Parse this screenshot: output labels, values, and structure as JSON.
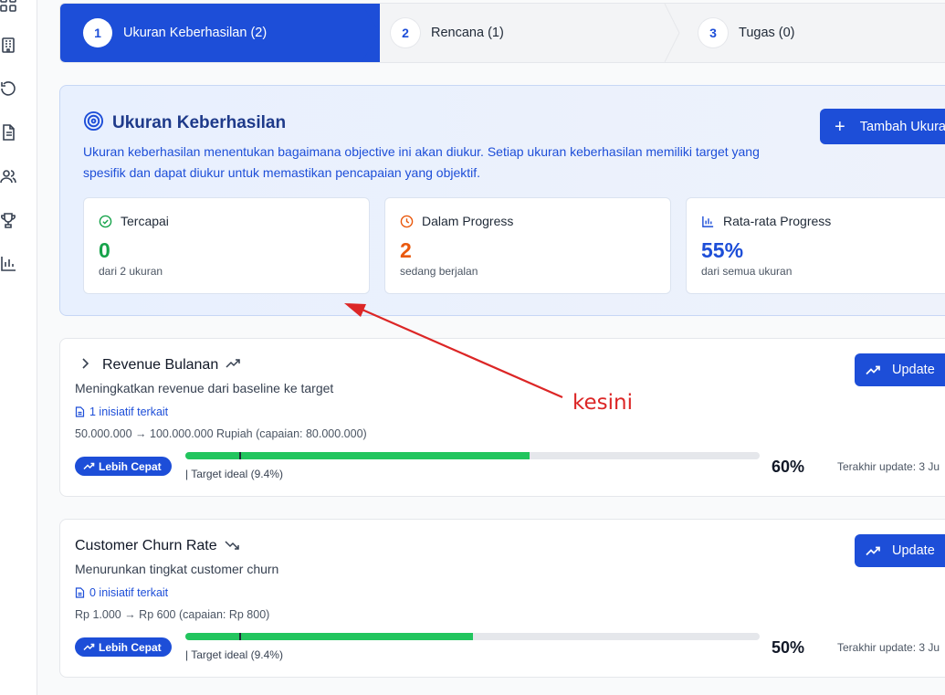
{
  "sidebar": {
    "icons": [
      "grid-icon",
      "building-icon",
      "history-icon",
      "document-icon",
      "users-icon",
      "trophy-icon",
      "bar-chart-icon"
    ]
  },
  "stepper": {
    "steps": [
      {
        "num": "1",
        "label": "Ukuran Keberhasilan (2)",
        "active": true
      },
      {
        "num": "2",
        "label": "Rencana (1)",
        "active": false
      },
      {
        "num": "3",
        "label": "Tugas (0)",
        "active": false
      }
    ]
  },
  "summary": {
    "title": "Ukuran Keberhasilan",
    "description": "Ukuran keberhasilan menentukan bagaimana objective ini akan diukur. Setiap ukuran keberhasilan memiliki target yang spesifik dan dapat diukur untuk memastikan pencapaian yang objektif.",
    "add_button": "Tambah Ukuran",
    "stats": [
      {
        "icon": "check-circle-icon",
        "label": "Tercapai",
        "value": "0",
        "sub": "dari 2 ukuran",
        "color": "#16a34a"
      },
      {
        "icon": "clock-icon",
        "label": "Dalam Progress",
        "value": "2",
        "sub": "sedang berjalan",
        "color": "#ea580c"
      },
      {
        "icon": "bar-chart-icon",
        "label": "Rata-rata Progress",
        "value": "55%",
        "sub": "dari semua ukuran",
        "color": "#1d4ed8"
      }
    ]
  },
  "measures": [
    {
      "title": "Revenue Bulanan",
      "trend": "up",
      "description": "Meningkatkan revenue dari baseline ke target",
      "link": "1 inisiatif terkait",
      "range": "50.000.000 → 100.000.000 Rupiah (capaian: 80.000.000)",
      "badge": "Lebih Cepat",
      "progress": 0.6,
      "target_ideal": "Target ideal (9.4%)",
      "percent": "60%",
      "last_update": "Terakhir update: 3 Ju",
      "update_button": "Update"
    },
    {
      "title": "Customer Churn Rate",
      "trend": "down",
      "description": "Menurunkan tingkat customer churn",
      "link": "0 inisiatif terkait",
      "range": "Rp 1.000 → Rp 600 (capaian: Rp 800)",
      "badge": "Lebih Cepat",
      "progress": 0.5,
      "target_ideal": "Target ideal (9.4%)",
      "percent": "50%",
      "last_update": "Terakhir update: 3 Ju",
      "update_button": "Update"
    }
  ],
  "annotation": {
    "text": "kesini",
    "color": "#dc2626"
  }
}
